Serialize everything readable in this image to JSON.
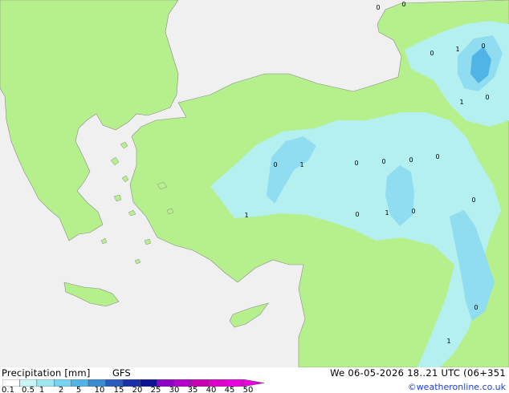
{
  "map": {
    "colors": {
      "sea": "#f0f0f0",
      "land": "#b6f08d",
      "coast": "#8a8a8a",
      "precip_light": "#b4f0f0",
      "precip_mid": "#90dcf0",
      "precip_heavy": "#50b4e6"
    },
    "cell_labels": [
      "0",
      "0",
      "0",
      "1",
      "0",
      "1",
      "0",
      "0",
      "1",
      "0",
      "0",
      "0",
      "0",
      "0",
      "1",
      "0",
      "1",
      "0",
      "0",
      "1"
    ]
  },
  "footer": {
    "title": "Precipitation [mm]",
    "model": "GFS",
    "run": "We 06-05-2026 18..21 UTC (06+351",
    "credit": "©weatheronline.co.uk",
    "legend": {
      "ticks": [
        "0.1",
        "0.5",
        "1",
        "2",
        "5",
        "10",
        "15",
        "20",
        "25",
        "30",
        "35",
        "40",
        "45",
        "50"
      ],
      "colors": [
        "#ffffff",
        "#c8f5f5",
        "#a0e6f0",
        "#78d2f0",
        "#50b4e6",
        "#3c8cd2",
        "#2a5abe",
        "#1a2faa",
        "#0c1496",
        "#8c00c8",
        "#b400c8",
        "#c800b4",
        "#dc00c8",
        "#e600dc"
      ]
    }
  }
}
